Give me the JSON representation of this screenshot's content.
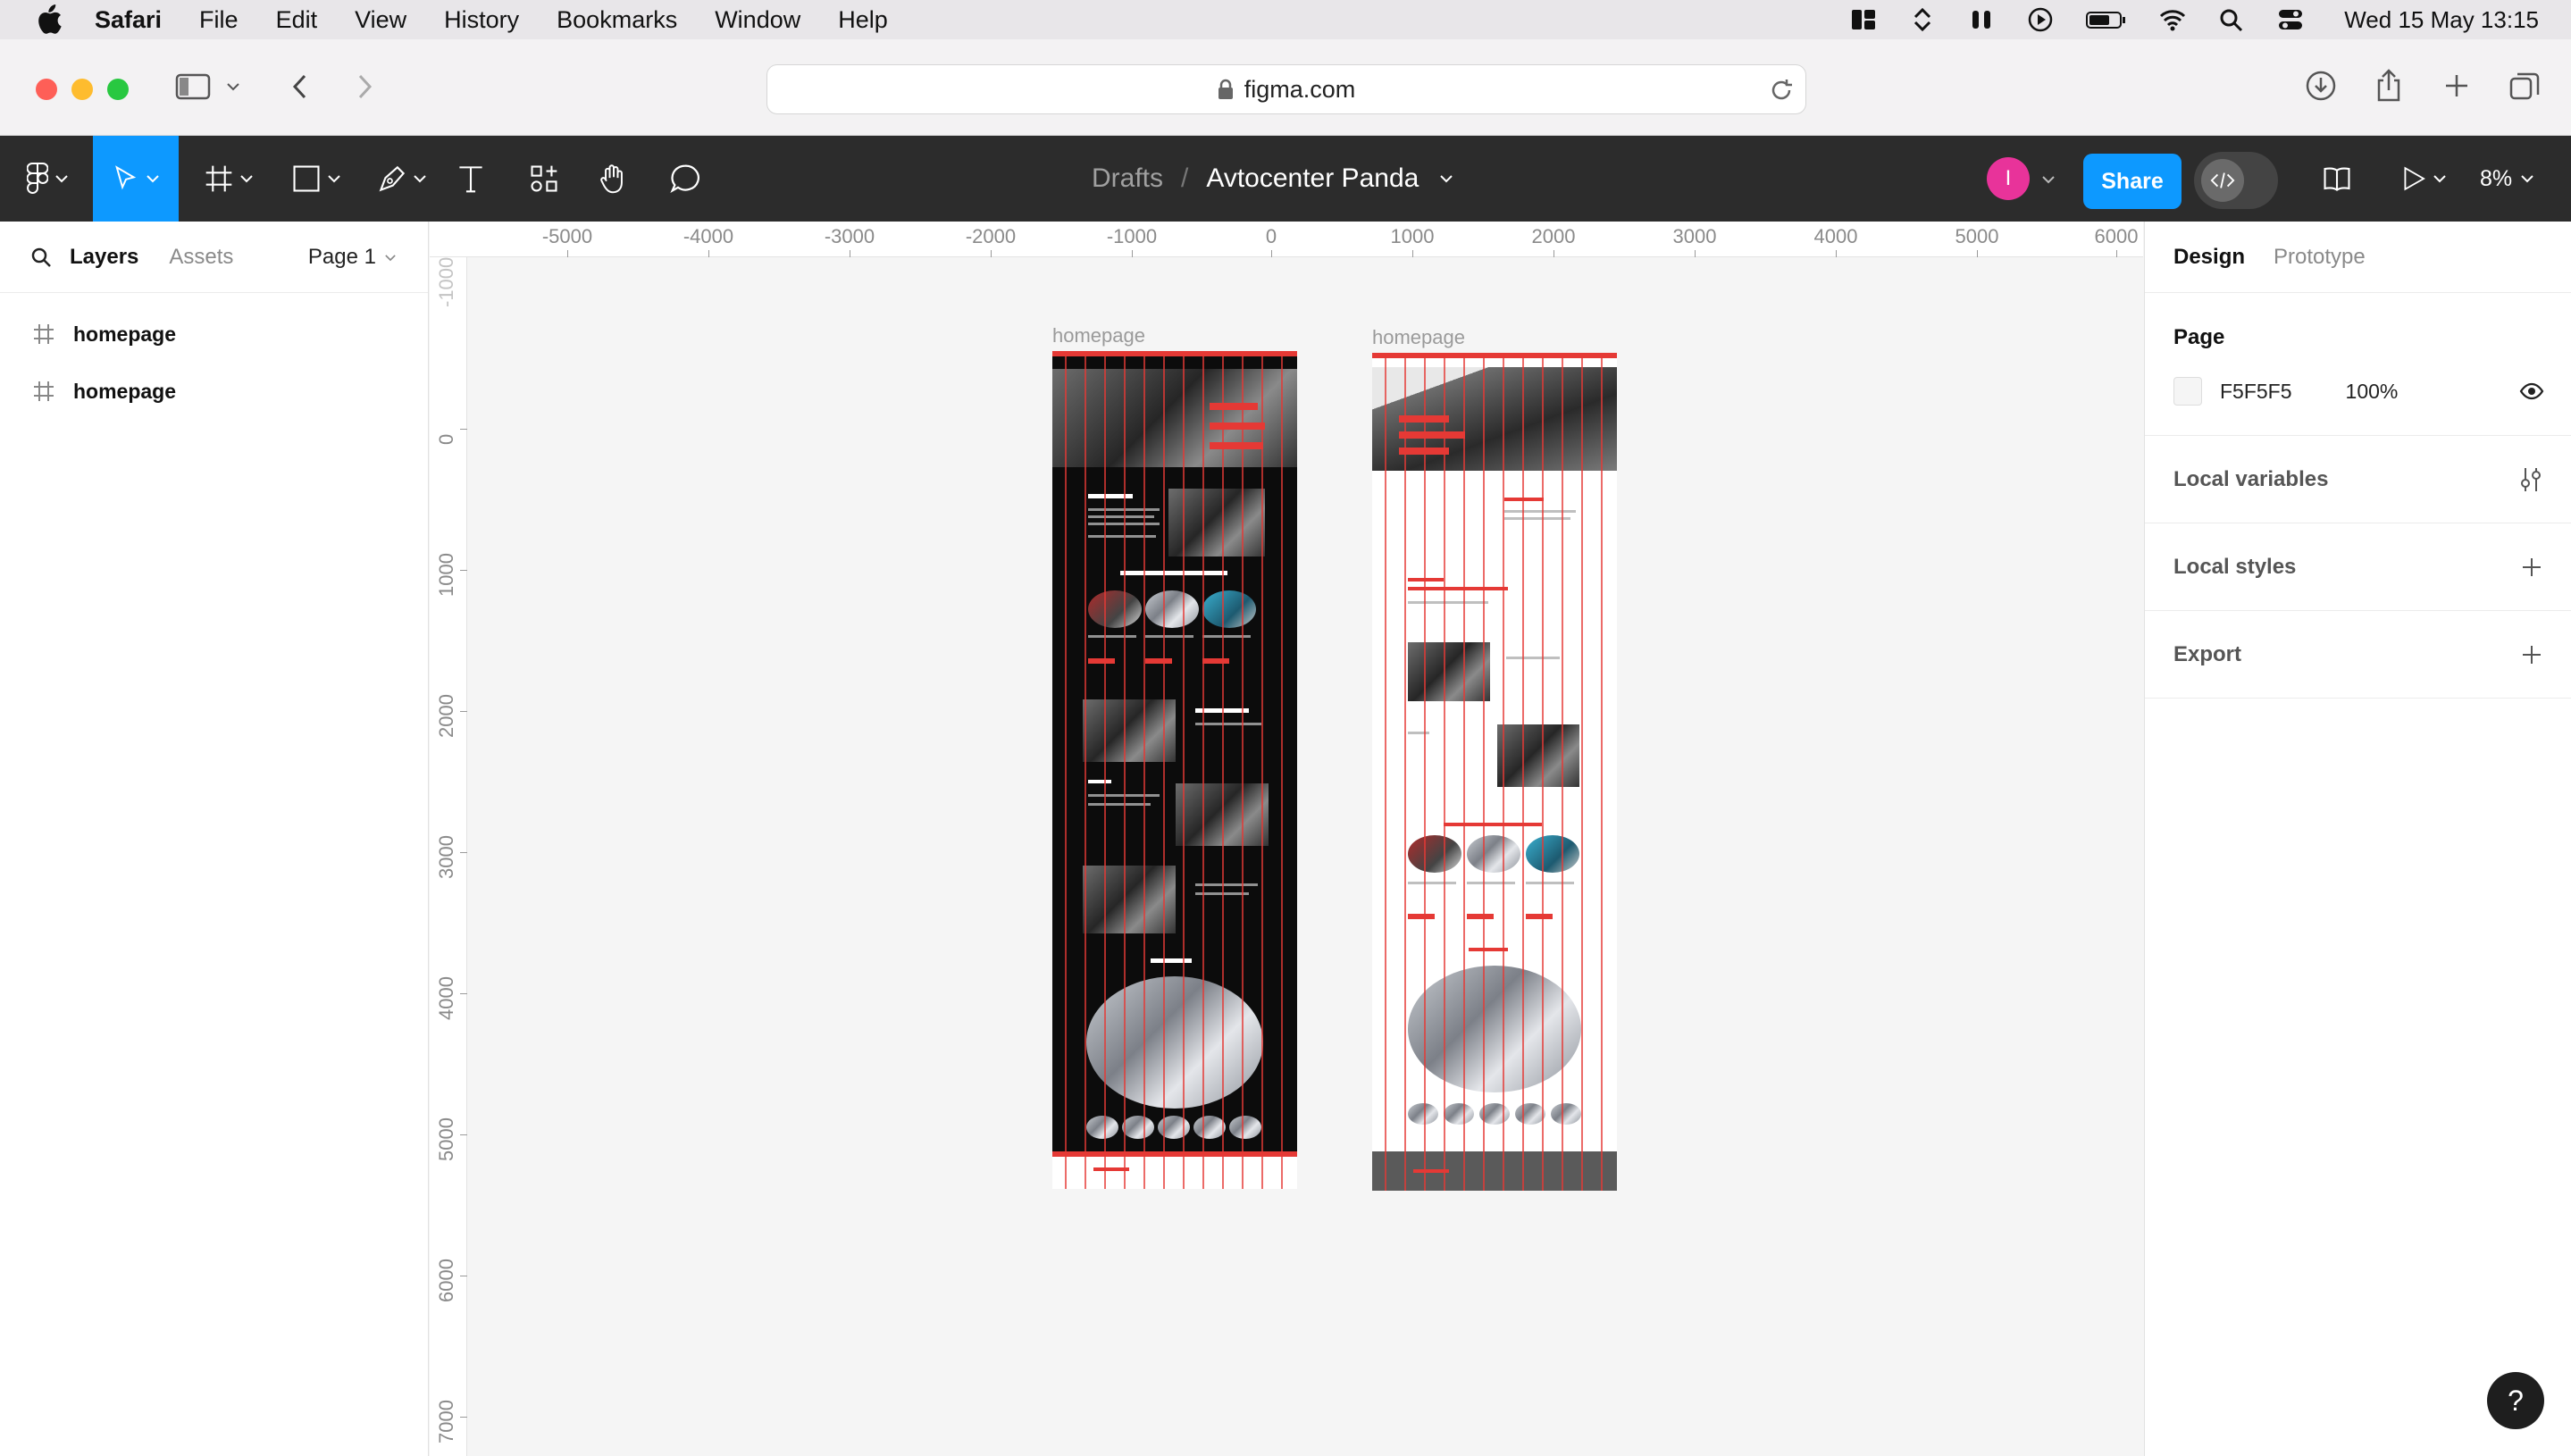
{
  "menubar": {
    "app_name": "Safari",
    "items": [
      "File",
      "Edit",
      "View",
      "History",
      "Bookmarks",
      "Window",
      "Help"
    ],
    "clock": "Wed 15 May  13:15"
  },
  "browser": {
    "url": "figma.com"
  },
  "figma": {
    "breadcrumb_root": "Drafts",
    "breadcrumb_sep": "/",
    "file_name": "Avtocenter Panda",
    "avatar_initial": "I",
    "share_label": "Share",
    "zoom": "8%"
  },
  "left_panel": {
    "tab_layers": "Layers",
    "tab_assets": "Assets",
    "page_selector": "Page 1",
    "layers": [
      "homepage",
      "homepage"
    ]
  },
  "rulers": {
    "top_labels": [
      "-5000",
      "-4000",
      "-3000",
      "-2000",
      "-1000",
      "0",
      "1000",
      "2000",
      "3000",
      "4000",
      "5000",
      "6000"
    ],
    "left_labels": [
      "-1000",
      "0",
      "1000",
      "2000",
      "3000",
      "4000",
      "5000",
      "6000",
      "7000"
    ]
  },
  "canvas": {
    "frame_labels": [
      "homepage",
      "homepage"
    ]
  },
  "right_panel": {
    "tab_design": "Design",
    "tab_prototype": "Prototype",
    "page_section": "Page",
    "page_color": "F5F5F5",
    "page_opacity": "100%",
    "local_variables": "Local variables",
    "local_styles": "Local styles",
    "export": "Export"
  },
  "help_label": "?",
  "colors": {
    "accent": "#0d99ff",
    "figma_dark": "#2c2c2c",
    "grid_red": "#e53935",
    "avatar": "#e8339a"
  }
}
